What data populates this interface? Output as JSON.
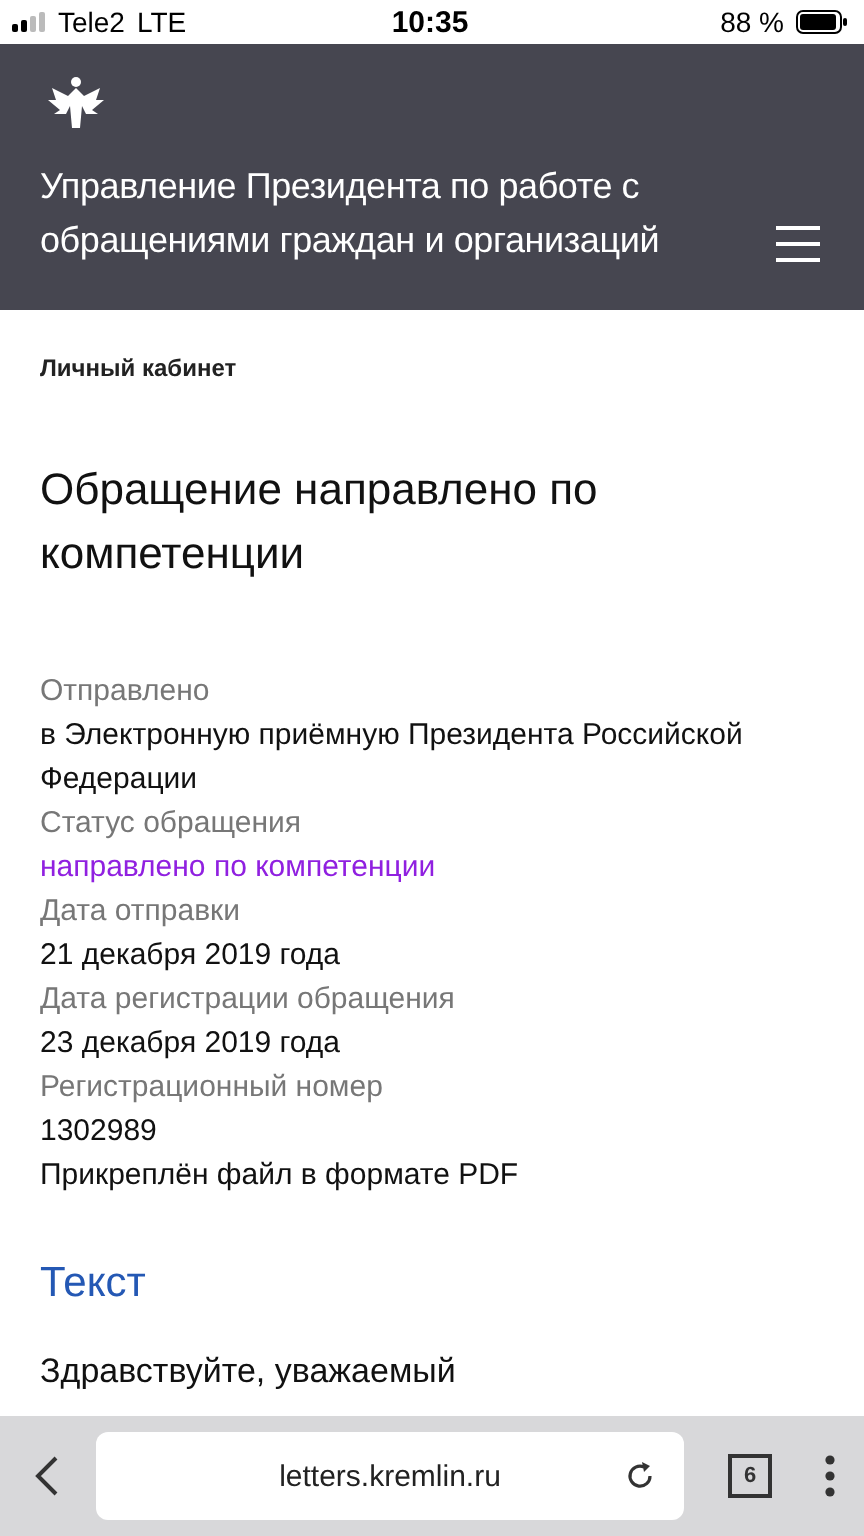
{
  "status_bar": {
    "carrier": "Tele2",
    "network": "LTE",
    "time": "10:35",
    "battery": "88 %"
  },
  "header": {
    "title": "Управление Президента по работе с обращениями граждан и организаций"
  },
  "breadcrumb": "Личный кабинет",
  "heading": "Обращение направлено по компетенции",
  "details": [
    {
      "kind": "label",
      "text": "Отправлено"
    },
    {
      "kind": "value",
      "text": "в Электронную приёмную Президента Российской Федерации"
    },
    {
      "kind": "label",
      "text": "Статус обращения"
    },
    {
      "kind": "status",
      "text": "направлено по компетенции"
    },
    {
      "kind": "label",
      "text": "Дата отправки"
    },
    {
      "kind": "value",
      "text": "21 декабря 2019 года"
    },
    {
      "kind": "label",
      "text": "Дата регистрации обращения"
    },
    {
      "kind": "value",
      "text": "23 декабря 2019 года"
    },
    {
      "kind": "label",
      "text": "Регистрационный номер"
    },
    {
      "kind": "value",
      "text": "1302989"
    },
    {
      "kind": "value",
      "text": "Прикреплён файл в формате PDF"
    }
  ],
  "section_title": "Текст",
  "body_text": "Здравствуйте, уважаемый",
  "browser_bar": {
    "url": "letters.kremlin.ru",
    "tabs_count": "6"
  }
}
